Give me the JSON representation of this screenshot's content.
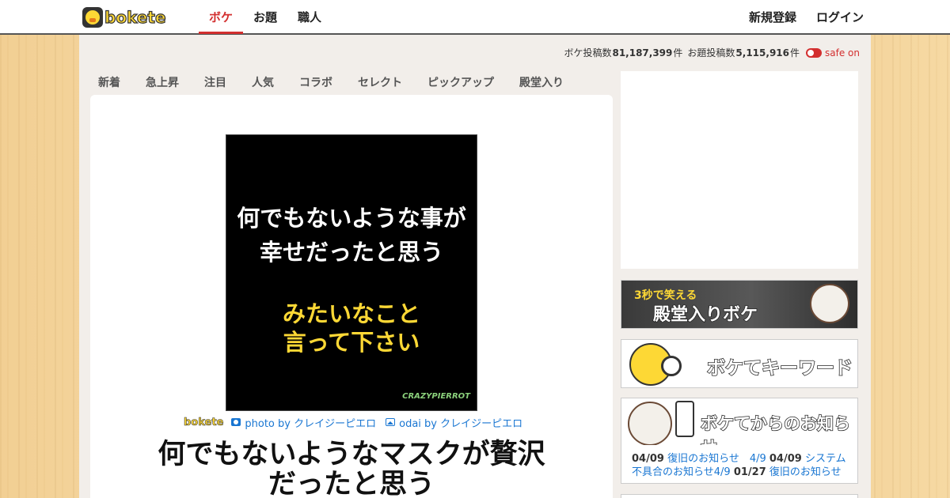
{
  "header": {
    "logo_text": "bokete",
    "nav": [
      {
        "label": "ボケ",
        "active": true
      },
      {
        "label": "お題",
        "active": false
      },
      {
        "label": "職人",
        "active": false
      }
    ],
    "signup_label": "新規登録",
    "login_label": "ログイン"
  },
  "stats": {
    "boke_label": "ボケ投稿数",
    "boke_count": "81,187,399",
    "boke_unit": "件",
    "odai_label": "お題投稿数",
    "odai_count": "5,115,916",
    "odai_unit": "件",
    "safe_label": "safe on",
    "safe_on": true
  },
  "tabs": [
    "新着",
    "急上昇",
    "注目",
    "人気",
    "コラボ",
    "セレクト",
    "ピックアップ",
    "殿堂入り"
  ],
  "post": {
    "image_lines_white": [
      "何でもないような事が",
      "幸せだったと思う"
    ],
    "image_lines_yellow": [
      "みたいなこと",
      "言って下さい"
    ],
    "image_watermark": "CRAZYPIERROT",
    "credit_logo": "bokete",
    "photo_credit": "photo by クレイジーピエロ",
    "odai_credit": "odai by クレイジーピエロ",
    "boke_text": "何でもないようなマスクが贅沢だったと思う"
  },
  "sidebar": {
    "hall_banner_sub": "3秒で笑える",
    "hall_banner_title": "殿堂入りボケ",
    "keyword_banner_title": "ボケてキーワード",
    "news_banner_title": "ボケてからのお知らせ",
    "news": [
      {
        "date": "04/09",
        "text": "復旧のお知らせ　4/9"
      },
      {
        "date": "04/09",
        "text": "システム不具合のお知らせ4/9"
      },
      {
        "date": "01/27",
        "text": "復旧のお知らせ"
      }
    ]
  },
  "colors": {
    "accent": "#d32f2f",
    "link": "#1976d2",
    "brand_yellow": "#fdd835"
  }
}
